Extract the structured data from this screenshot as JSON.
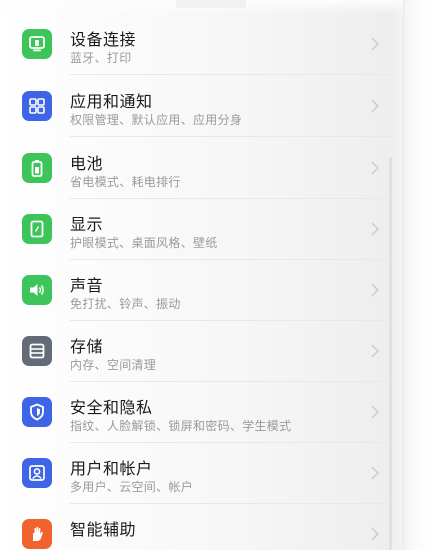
{
  "settings_list": {
    "items": [
      {
        "title": "设备连接",
        "subtitle": "蓝牙、打印",
        "icon": "device-connection-icon",
        "color": "#3dc45a"
      },
      {
        "title": "应用和通知",
        "subtitle": "权限管理、默认应用、应用分身",
        "icon": "apps-grid-icon",
        "color": "#3f64e6"
      },
      {
        "title": "电池",
        "subtitle": "省电模式、耗电排行",
        "icon": "battery-icon",
        "color": "#3dc45a"
      },
      {
        "title": "显示",
        "subtitle": "护眼模式、桌面风格、壁纸",
        "icon": "display-icon",
        "color": "#3dc45a"
      },
      {
        "title": "声音",
        "subtitle": "免打扰、铃声、振动",
        "icon": "speaker-icon",
        "color": "#3dc45a"
      },
      {
        "title": "存储",
        "subtitle": "内存、空间清理",
        "icon": "storage-icon",
        "color": "#636a78"
      },
      {
        "title": "安全和隐私",
        "subtitle": "指纹、人脸解锁、锁屏和密码、学生模式",
        "icon": "shield-icon",
        "color": "#3f64e6"
      },
      {
        "title": "用户和帐户",
        "subtitle": "多用户、云空间、帐户",
        "icon": "user-account-icon",
        "color": "#3f64e6"
      },
      {
        "title": "智能辅助",
        "subtitle": "",
        "icon": "hand-icon",
        "color": "#f0632e"
      }
    ]
  }
}
